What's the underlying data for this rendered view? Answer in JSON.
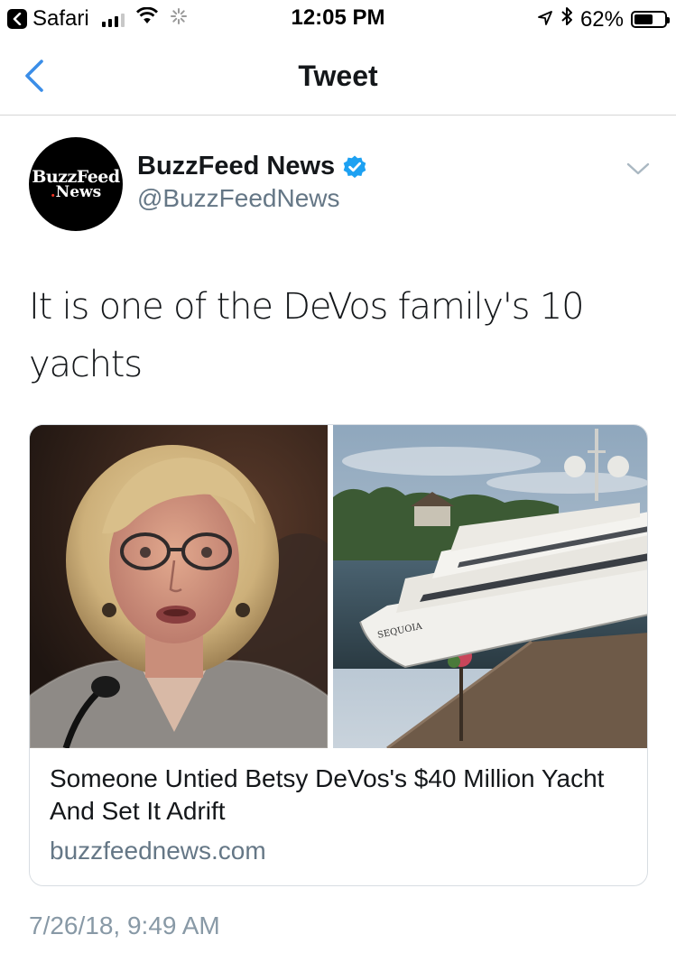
{
  "status_bar": {
    "back_app": "Safari",
    "time": "12:05 PM",
    "battery": "62%",
    "battery_level": 0.62,
    "icons": [
      "back-arrow-icon",
      "signal-icon",
      "wifi-icon",
      "loading-spinner-icon",
      "location-arrow-icon",
      "bluetooth-icon",
      "battery-icon"
    ]
  },
  "nav": {
    "title": "Tweet",
    "back_icon": "chevron-left-icon"
  },
  "tweet": {
    "author": {
      "avatar_line1": "BuzzFeed",
      "avatar_line2": "News",
      "display_name": "BuzzFeed News",
      "handle": "@BuzzFeedNews",
      "verified": true
    },
    "text": "It is one of the DeVos family's 10 yachts",
    "timestamp": "7/26/18, 9:49 AM"
  },
  "card": {
    "title": "Someone Untied Betsy DeVos's $40 Million Yacht And Set It Adrift",
    "domain": "buzzfeednews.com",
    "yacht_name": "SEQUOIA"
  },
  "colors": {
    "accent": "#1da1f2",
    "back_chevron": "#3b8ee8",
    "secondary_text": "#657786",
    "timestamp": "#8899a6",
    "border": "#d8dde2"
  }
}
